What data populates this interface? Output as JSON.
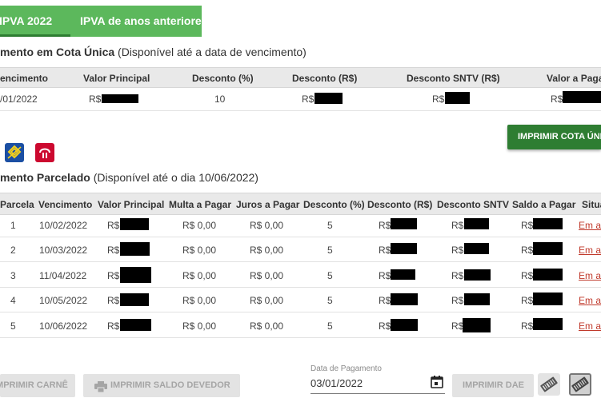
{
  "tabs": {
    "current": "IPVA 2022",
    "previous": "IPVA de anos anteriores"
  },
  "cota_unica": {
    "title_bold": "mento em Cota Única",
    "title_note": " (Disponível até a data de vencimento)",
    "headers": [
      "encimento",
      "Valor Principal",
      "Desconto (%)",
      "Desconto (R$)",
      "Desconto SNTV (R$)",
      "Valor a Pagar"
    ],
    "row": {
      "vencimento": "/01/2022",
      "valor": "R$",
      "desconto_pct": "10",
      "desconto_rs": "R$",
      "desconto_sntv": "R$",
      "valor_pagar": "R$"
    },
    "print_button": "IMPRIMIR COTA ÚNICA"
  },
  "parcelado": {
    "title_bold": "mento Parcelado",
    "title_note": " (Disponível até o dia 10/06/2022)",
    "headers": [
      "Parcela",
      "Vencimento",
      "Valor Principal",
      "Multa a Pagar",
      "Juros a Pagar",
      "Desconto (%)",
      "Desconto (R$)",
      "Desconto SNTV",
      "Saldo a Pagar",
      "Situa"
    ],
    "rows": [
      {
        "parcela": "1",
        "vencimento": "10/02/2022",
        "valor": "R$",
        "multa": "R$ 0,00",
        "juros": "R$ 0,00",
        "desconto_pct": "5",
        "desconto_rs": "R$",
        "sntv": "R$",
        "saldo": "R$",
        "situacao": "Em a"
      },
      {
        "parcela": "2",
        "vencimento": "10/03/2022",
        "valor": "R$",
        "multa": "R$ 0,00",
        "juros": "R$ 0,00",
        "desconto_pct": "5",
        "desconto_rs": "R$",
        "sntv": "R$",
        "saldo": "R$",
        "situacao": "Em a"
      },
      {
        "parcela": "3",
        "vencimento": "11/04/2022",
        "valor": "R$",
        "multa": "R$ 0,00",
        "juros": "R$ 0,00",
        "desconto_pct": "5",
        "desconto_rs": "R$",
        "sntv": "R$",
        "saldo": "R$",
        "situacao": "Em a"
      },
      {
        "parcela": "4",
        "vencimento": "10/05/2022",
        "valor": "R$",
        "multa": "R$ 0,00",
        "juros": "R$ 0,00",
        "desconto_pct": "5",
        "desconto_rs": "R$",
        "sntv": "R$",
        "saldo": "R$",
        "situacao": "Em a"
      },
      {
        "parcela": "5",
        "vencimento": "10/06/2022",
        "valor": "R$",
        "multa": "R$ 0,00",
        "juros": "R$ 0,00",
        "desconto_pct": "5",
        "desconto_rs": "R$",
        "sntv": "R$",
        "saldo": "R$",
        "situacao": "Em a"
      }
    ]
  },
  "footer": {
    "print_carne": "IMPRIMIR CARNÊ",
    "print_saldo": "IMPRIMIR SALDO DEVEDOR",
    "date_label": "Data de Pagamento",
    "date_value": "03/01/2022",
    "print_dae": "IMPRIMIR DAE"
  },
  "colors": {
    "tab_bg": "#5cb85c",
    "primary_green": "#2e7d32",
    "link_red": "#c0392b",
    "header_bg": "#e9e9e9"
  },
  "icons": [
    "banco-do-brasil-icon",
    "bradesco-icon",
    "calendar-icon",
    "printer-icon",
    "barcode-icon"
  ]
}
